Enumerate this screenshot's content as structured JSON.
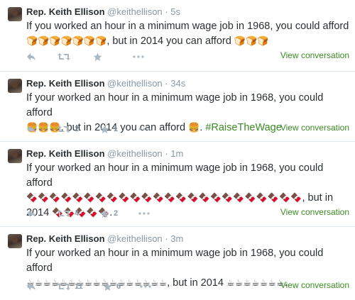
{
  "tweets": [
    {
      "name": "Rep. Keith Ellison",
      "handle": "@keithellison",
      "sep": "·",
      "time": "5s",
      "text_pre": "If you worked an hour in a minimum wage job in 1968, you could afford",
      "emoji_1968": "🍞🍞🍞🍞🍞🍞🍞",
      "text_mid": ", but in 2014 you can afford",
      "emoji_2014": "🍞🍞🍞",
      "text_post": "",
      "retweets": "",
      "favorites": "",
      "view_conversation": "View conversation"
    },
    {
      "name": "Rep. Keith Ellison",
      "handle": "@keithellison",
      "sep": "·",
      "time": "34s",
      "text_pre": "If your worked an hour in a minimum wage job in 1968, you could afford",
      "emoji_1968": "🍔🍔🍔",
      "text_mid": ", but in 2014 you can afford",
      "emoji_2014": "🍔",
      "text_post": ". ",
      "hashtag": "#RaiseTheWage",
      "retweets": "2",
      "favorites": "1",
      "view_conversation": "View conversation"
    },
    {
      "name": "Rep. Keith Ellison",
      "handle": "@keithellison",
      "sep": "·",
      "time": "1m",
      "text_pre": "If your worked an hour in a minimum wage job in 1968, you could afford",
      "emoji_1968": "🍫🍫🍫🍫🍫🍫🍫🍫🍫🍫🍫🍫🍫🍫🍫🍫🍫🍫🍫🍫🍫🍫🍫🍫",
      "text_mid": ", but in 2014",
      "emoji_2014": "🍫🍫🍫🍫🍫",
      "text_post": ".",
      "retweets": "4",
      "favorites": "2",
      "view_conversation": "View conversation"
    },
    {
      "name": "Rep. Keith Ellison",
      "handle": "@keithellison",
      "sep": "·",
      "time": "3m",
      "text_pre": "If your worked an hour in a minimum wage job in 1968, you could afford",
      "emoji_1968": "☕☕☕☕☕☕☕☕☕☕☕☕☕☕☕☕☕",
      "text_mid": ", but in 2014",
      "emoji_2014": "☕☕☕☕☕☕☕",
      "text_post": ".",
      "retweets": "11",
      "favorites": "6",
      "view_conversation": "View conversation"
    }
  ],
  "colors": {
    "link": "#3b8a24",
    "muted": "#8899a6",
    "icon": "#aab8c2",
    "text": "#292f33"
  },
  "icons": [
    "reply-icon",
    "retweet-icon",
    "favorite-star-icon",
    "more-dots-icon"
  ]
}
